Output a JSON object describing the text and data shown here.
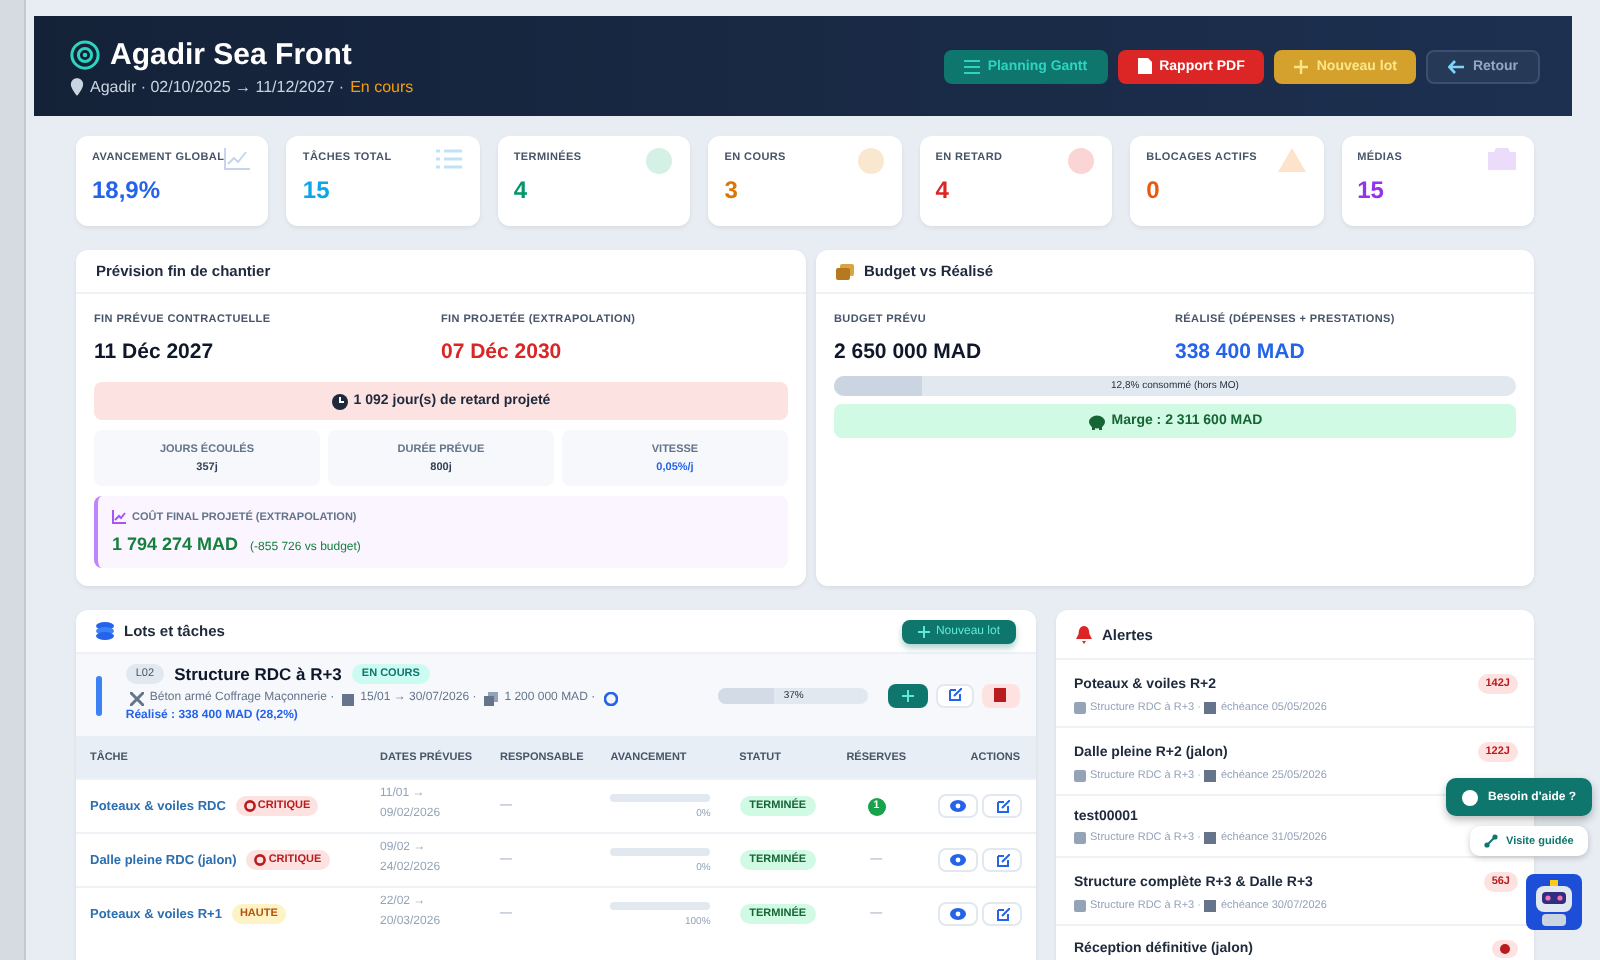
{
  "header": {
    "title": "Agadir Sea Front",
    "subtitle": "Agadir · 02/10/2025 → 11/12/2027 ·",
    "status": "En cours",
    "buttons": [
      {
        "label": "Planning Gantt",
        "kind": "gantt"
      },
      {
        "label": "Rapport PDF",
        "kind": "pdf"
      },
      {
        "label": "Nouveau lot",
        "kind": "new"
      },
      {
        "label": "Retour",
        "kind": "back"
      }
    ]
  },
  "stats": [
    {
      "label": "AVANCEMENT GLOBAL",
      "value": "18,9%",
      "kind": "progress"
    },
    {
      "label": "TÂCHES TOTAL",
      "value": "15",
      "kind": "tasks"
    },
    {
      "label": "TERMINÉES",
      "value": "4",
      "kind": "done"
    },
    {
      "label": "EN COURS",
      "value": "3",
      "kind": "running"
    },
    {
      "label": "EN RETARD",
      "value": "4",
      "kind": "late"
    },
    {
      "label": "BLOCAGES ACTIFS",
      "value": "0",
      "kind": "blocked"
    },
    {
      "label": "MÉDIAS",
      "value": "15",
      "kind": "media"
    }
  ],
  "forecast": {
    "title": "Prévision fin de chantier",
    "contract_label": "FIN PRÉVUE CONTRACTUELLE",
    "contract_value": "11 Déc 2027",
    "projected_label": "FIN PROJETÉE (EXTRAPOLATION)",
    "projected_value": "07 Déc 2030",
    "delay": "1 092 jour(s) de retard projeté",
    "metrics": [
      {
        "label": "JOURS ÉCOULÉS",
        "value": "357j",
        "kind": "plain"
      },
      {
        "label": "DURÉE PRÉVUE",
        "value": "800j",
        "kind": "plain"
      },
      {
        "label": "VITESSE",
        "value": "0,05%/j",
        "kind": "speed"
      }
    ],
    "cost": {
      "label": "COÛT FINAL PROJETÉ (EXTRAPOLATION)",
      "value": "1 794 274 MAD",
      "diff": "(-855 726 vs budget)"
    }
  },
  "budget": {
    "title": "Budget vs Réalisé",
    "budget_label": "BUDGET PRÉVU",
    "budget_value": "2 650 000 MAD",
    "actual_label": "RÉALISÉ (DÉPENSES + PRESTATIONS)",
    "actual_value": "338 400 MAD",
    "consumed": {
      "level": 0.128,
      "label": "12,8% consommé (hors MO)"
    },
    "margin": "Marge : 2 311 600 MAD"
  },
  "lots": {
    "title": "Lots et tâches",
    "button": "Nouveau lot",
    "lot": {
      "code": "L02",
      "name": "Structure RDC à R+3",
      "status": "EN COURS",
      "trades": "Béton armé Coffrage Maçonnerie ·",
      "dates": "15/01 → 30/07/2026 ·",
      "amount": "1 200 000 MAD ·",
      "realised": "Réalisé : 338 400 MAD (28,2%)",
      "progress": {
        "level": 0.37,
        "label": "37%"
      }
    },
    "columns": [
      "TÂCHE",
      "DATES PRÉVUES",
      "RESPONSABLE",
      "AVANCEMENT",
      "STATUT",
      "RÉSERVES",
      "ACTIONS"
    ],
    "rows": [
      {
        "task": "Poteaux & voiles RDC",
        "priority": {
          "label": "CRITIQUE",
          "kind": "critical"
        },
        "start": "11/01 →",
        "end": "09/02/2026",
        "responsible": "—",
        "level": 0,
        "reading": "0%",
        "status": "TERMINÉE",
        "reserves": "1"
      },
      {
        "task": "Dalle pleine RDC (jalon)",
        "priority": {
          "label": "CRITIQUE",
          "kind": "critical"
        },
        "start": "09/02 →",
        "end": "24/02/2026",
        "responsible": "—",
        "level": 0,
        "reading": "0%",
        "status": "TERMINÉE",
        "reserves": "—"
      },
      {
        "task": "Poteaux & voiles R+1",
        "priority": {
          "label": "HAUTE",
          "kind": "high"
        },
        "start": "22/02 →",
        "end": "20/03/2026",
        "responsible": "—",
        "level": 0,
        "reading": "100%",
        "status": "TERMINÉE",
        "reserves": "—"
      }
    ]
  },
  "alerts": {
    "title": "Alertes",
    "items": [
      {
        "title": "Poteaux & voiles R+2",
        "lot": "Structure RDC à R+3 ·",
        "due": "échéance 05/05/2026",
        "badge": "142J",
        "kind": "days"
      },
      {
        "title": "Dalle pleine R+2 (jalon)",
        "lot": "Structure RDC à R+3 ·",
        "due": "échéance 25/05/2026",
        "badge": "122J",
        "kind": "days"
      },
      {
        "title": "test00001",
        "lot": "Structure RDC à R+3 ·",
        "due": "échéance 31/05/2026",
        "kind": "hidden"
      },
      {
        "title": "Structure complète R+3 & Dalle R+3",
        "lot": "Structure RDC à R+3 ·",
        "due": "échéance 30/07/2026",
        "badge": "56J",
        "kind": "days"
      },
      {
        "title": "Réception définitive (jalon)",
        "kind": "milestone"
      }
    ]
  },
  "help": {
    "button": "Besoin d'aide ?",
    "tour": "Visite guidée"
  }
}
